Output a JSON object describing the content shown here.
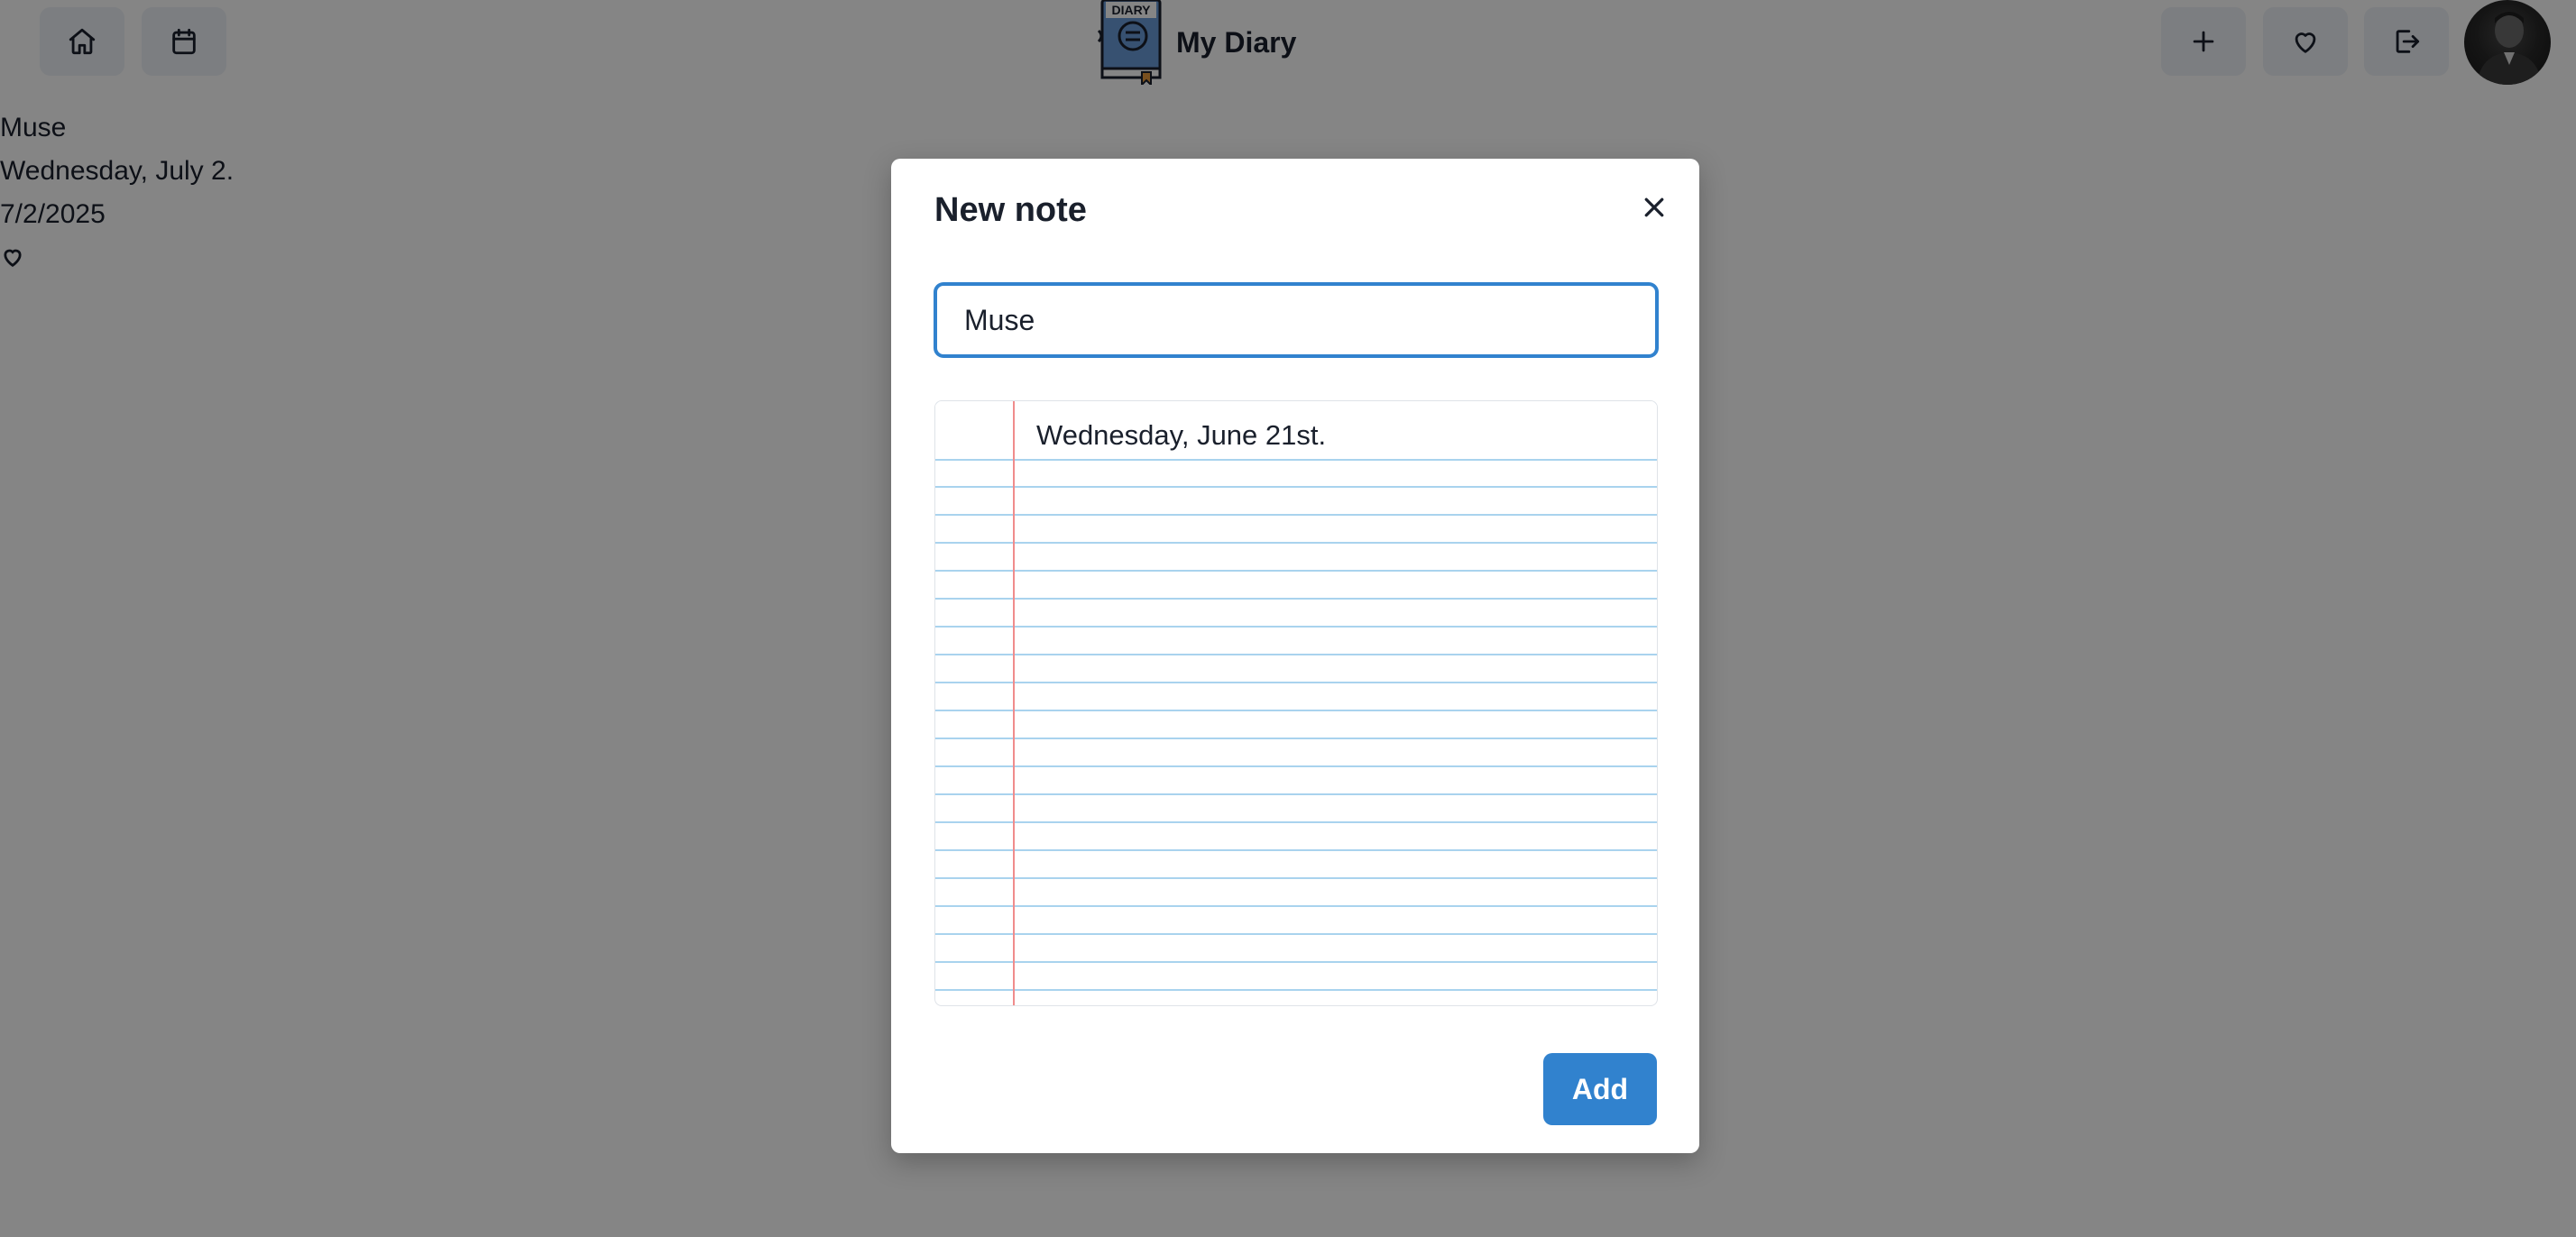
{
  "header": {
    "title": "My Diary",
    "logo_text": "DIARY",
    "left_buttons": [
      {
        "icon": "home-icon"
      },
      {
        "icon": "calendar-icon"
      }
    ],
    "right_buttons": [
      {
        "icon": "plus-icon"
      },
      {
        "icon": "heart-icon"
      },
      {
        "icon": "logout-icon"
      }
    ]
  },
  "background_note": {
    "title": "Muse",
    "text": "Wednesday, July 2.",
    "date": "7/2/2025",
    "favorite_icon": "heart-outline-icon"
  },
  "modal": {
    "title": "New note",
    "title_input_value": "Muse",
    "body_text": "Wednesday, June 21st.",
    "submit_label": "Add"
  },
  "colors": {
    "accent": "#3182ce",
    "overlay": "rgba(0,0,0,0.48)",
    "paper_line": "#a9d3ee",
    "paper_margin": "#f08c8c"
  }
}
